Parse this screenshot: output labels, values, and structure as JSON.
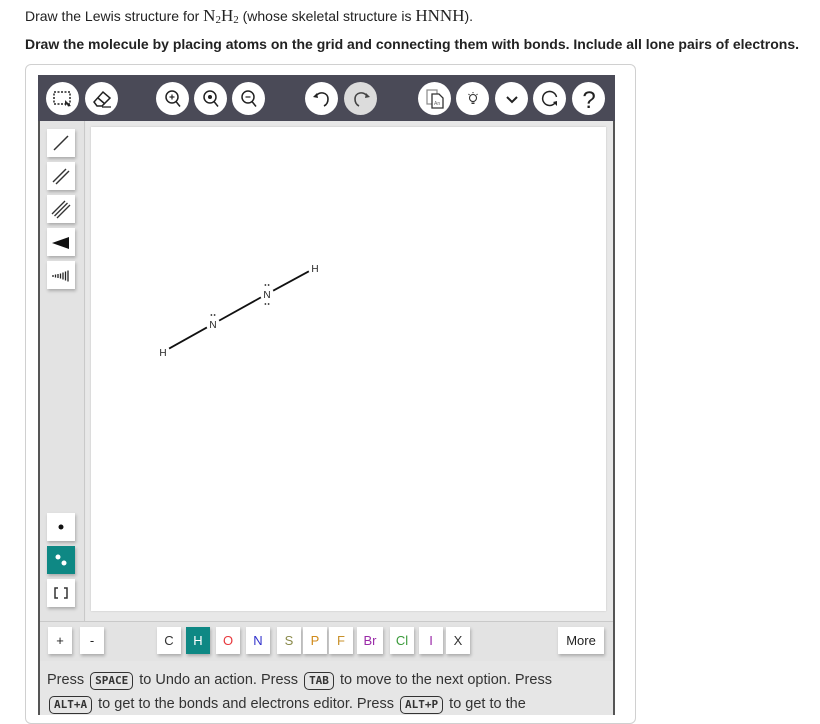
{
  "question": {
    "line1_prefix": "Draw the Lewis structure for ",
    "formula": {
      "n": "N",
      "n_sub": "2",
      "h": "H",
      "h_sub": "2"
    },
    "line1_middle": " (whose skeletal structure is ",
    "skeleton": "HNNH",
    "line1_suffix": ").",
    "line2": "Draw the molecule by placing atoms on the grid and connecting them with bonds. Include all lone pairs of electrons."
  },
  "toolbar": {
    "buttons": [
      {
        "name": "marquee-select",
        "icon": "marquee-select-icon"
      },
      {
        "name": "erase",
        "icon": "eraser-icon"
      },
      {
        "name": "zoom-in",
        "icon": "zoom-in-icon"
      },
      {
        "name": "zoom-reset",
        "icon": "zoom-reset-icon"
      },
      {
        "name": "zoom-out",
        "icon": "zoom-out-icon"
      },
      {
        "name": "undo",
        "icon": "undo-icon"
      },
      {
        "name": "redo",
        "icon": "redo-icon",
        "disabled": true
      },
      {
        "name": "templates",
        "icon": "templates-icon"
      },
      {
        "name": "hint",
        "icon": "lightbulb-icon"
      },
      {
        "name": "more-options",
        "icon": "chevron-down-icon"
      },
      {
        "name": "reset",
        "icon": "reset-icon"
      },
      {
        "name": "help",
        "icon": "question-icon"
      }
    ]
  },
  "sidebar": {
    "bond_tools": [
      "single-bond",
      "double-bond",
      "triple-bond",
      "wedge-bond",
      "hash-bond"
    ],
    "electron_tools": [
      "lone-electron",
      "lone-pair",
      "brackets"
    ],
    "active_tool": "lone-pair"
  },
  "molecule": {
    "atoms": [
      {
        "symbol": "H",
        "lone_pairs": 0
      },
      {
        "symbol": "N",
        "lone_pairs": 1
      },
      {
        "symbol": "N",
        "lone_pairs": 2
      },
      {
        "symbol": "H",
        "lone_pairs": 0
      }
    ],
    "bonds": [
      {
        "from": 0,
        "to": 1,
        "order": 1
      },
      {
        "from": 1,
        "to": 2,
        "order": 1
      },
      {
        "from": 2,
        "to": 3,
        "order": 1
      }
    ]
  },
  "charge_buttons": {
    "plus": "+",
    "minus": "-"
  },
  "elements": [
    {
      "symbol": "C",
      "color": "#333333"
    },
    {
      "symbol": "H",
      "color": "#ffffff",
      "active": true
    },
    {
      "symbol": "O",
      "color": "#e8383d"
    },
    {
      "symbol": "N",
      "color": "#3333cc"
    },
    {
      "symbol": "S",
      "color": "#8a8a4a"
    },
    {
      "symbol": "P",
      "color": "#d08a1a"
    },
    {
      "symbol": "F",
      "color": "#c8902a"
    },
    {
      "symbol": "Br",
      "color": "#9a2aa8"
    },
    {
      "symbol": "Cl",
      "color": "#3a9a3a"
    },
    {
      "symbol": "I",
      "color": "#9a2aa8"
    },
    {
      "symbol": "X",
      "color": "#333333"
    }
  ],
  "more_label": "More",
  "help": {
    "t1": "Press ",
    "k1": "SPACE",
    "t2": " to Undo an action. Press ",
    "k2": "TAB",
    "t3": " to move to the next option. Press",
    "k3": "ALT+A",
    "t4": " to get to the bonds and electrons editor. Press ",
    "k4": "ALT+P",
    "t5": " to get to the"
  },
  "colors": {
    "toolbar_bg": "#4a4a57",
    "accent_teal": "#0e8884"
  }
}
